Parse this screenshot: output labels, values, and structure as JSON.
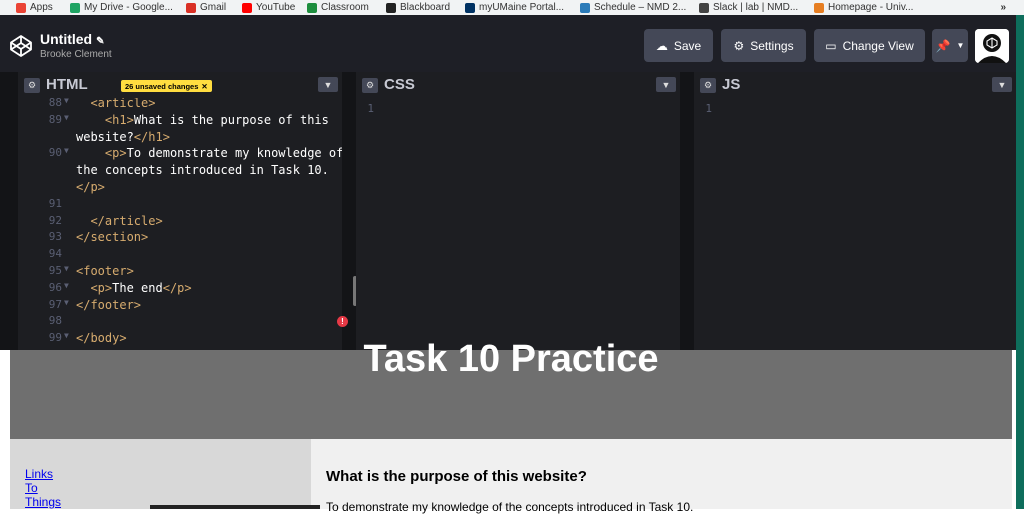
{
  "bookmarks": [
    {
      "label": "Apps",
      "icon": "apps-grid-icon",
      "color": "#ea4335"
    },
    {
      "label": "My Drive - Google...",
      "icon": "google-drive-icon",
      "color": "#1fa463"
    },
    {
      "label": "Gmail",
      "icon": "gmail-icon",
      "color": "#d93025"
    },
    {
      "label": "YouTube",
      "icon": "youtube-icon",
      "color": "#ff0000"
    },
    {
      "label": "Classroom",
      "icon": "classroom-icon",
      "color": "#1e8e3e"
    },
    {
      "label": "Blackboard",
      "icon": "blackboard-icon",
      "color": "#222222"
    },
    {
      "label": "myUMaine Portal...",
      "icon": "umaine-icon",
      "color": "#003263"
    },
    {
      "label": "Schedule – NMD 2...",
      "icon": "schedule-icon",
      "color": "#2b7bb9"
    },
    {
      "label": "Slack | lab | NMD...",
      "icon": "slack-icon",
      "color": "#444444"
    },
    {
      "label": "Homepage - Univ...",
      "icon": "homepage-icon",
      "color": "#e67e22"
    }
  ],
  "bookmarks_overflow": "»",
  "header": {
    "title": "Untitled",
    "author": "Brooke Clement",
    "save_label": "Save",
    "settings_label": "Settings",
    "change_view_label": "Change View"
  },
  "html_pane": {
    "title": "HTML",
    "badge": "26 unsaved changes",
    "lines": [
      {
        "num": "88",
        "fold": true,
        "parts": [
          {
            "t": "  ",
            "c": "txt"
          },
          {
            "t": "<article>",
            "c": "tag"
          }
        ]
      },
      {
        "num": "89",
        "fold": true,
        "parts": [
          {
            "t": "    ",
            "c": "txt"
          },
          {
            "t": "<h1>",
            "c": "tag"
          },
          {
            "t": "What is the purpose of this",
            "c": "txt"
          }
        ]
      },
      {
        "num": "",
        "fold": false,
        "parts": [
          {
            "t": "website?",
            "c": "txt"
          },
          {
            "t": "</h1>",
            "c": "tag"
          }
        ]
      },
      {
        "num": "90",
        "fold": true,
        "parts": [
          {
            "t": "    ",
            "c": "txt"
          },
          {
            "t": "<p>",
            "c": "tag"
          },
          {
            "t": "To demonstrate my knowledge of",
            "c": "txt"
          }
        ]
      },
      {
        "num": "",
        "fold": false,
        "parts": [
          {
            "t": "the concepts introduced in Task 10.",
            "c": "txt"
          }
        ]
      },
      {
        "num": "",
        "fold": false,
        "parts": [
          {
            "t": "</p>",
            "c": "tag"
          }
        ]
      },
      {
        "num": "91",
        "fold": false,
        "parts": []
      },
      {
        "num": "92",
        "fold": false,
        "parts": [
          {
            "t": "  ",
            "c": "txt"
          },
          {
            "t": "</article>",
            "c": "tag"
          }
        ]
      },
      {
        "num": "93",
        "fold": false,
        "parts": [
          {
            "t": "</section>",
            "c": "tag"
          }
        ]
      },
      {
        "num": "94",
        "fold": false,
        "parts": []
      },
      {
        "num": "95",
        "fold": true,
        "parts": [
          {
            "t": "<footer>",
            "c": "tag"
          }
        ]
      },
      {
        "num": "96",
        "fold": true,
        "parts": [
          {
            "t": "  ",
            "c": "txt"
          },
          {
            "t": "<p>",
            "c": "tag"
          },
          {
            "t": "The end",
            "c": "txt"
          },
          {
            "t": "</p>",
            "c": "tag"
          }
        ]
      },
      {
        "num": "97",
        "fold": true,
        "parts": [
          {
            "t": "</footer>",
            "c": "tag"
          }
        ]
      },
      {
        "num": "98",
        "fold": false,
        "parts": []
      },
      {
        "num": "99",
        "fold": true,
        "parts": [
          {
            "t": "</body>",
            "c": "tag"
          }
        ]
      }
    ]
  },
  "css_pane": {
    "title": "CSS",
    "line_number": "1"
  },
  "js_pane": {
    "title": "JS",
    "line_number": "1"
  },
  "preview": {
    "heading": "Task 10 Practice",
    "nav_links": [
      "Links",
      "To",
      "Things"
    ],
    "article_heading": "What is the purpose of this website?",
    "article_text": "To demonstrate my knowledge of the concepts introduced in Task 10."
  }
}
